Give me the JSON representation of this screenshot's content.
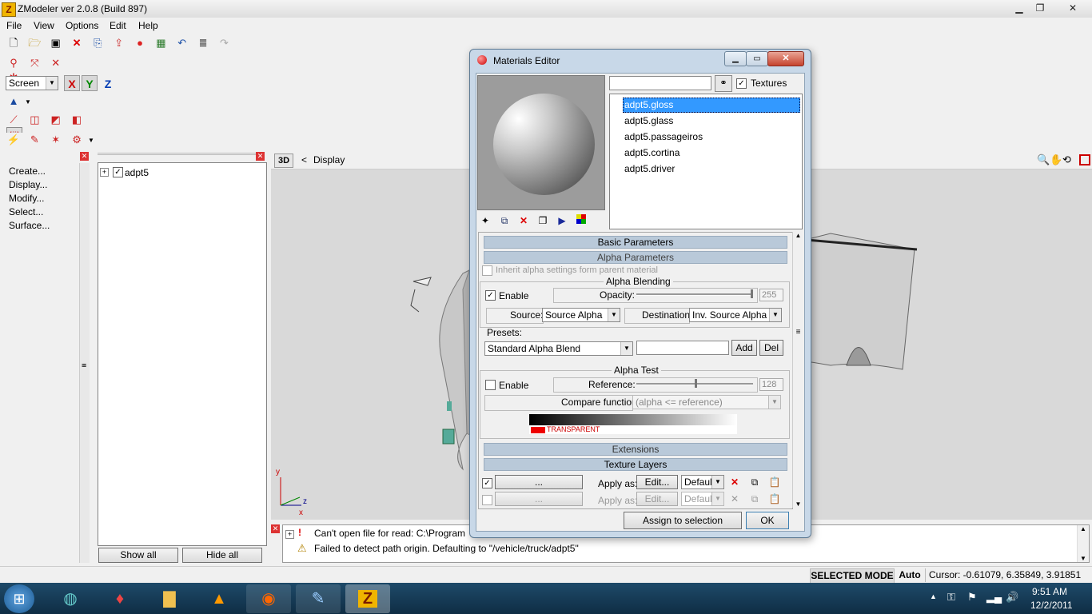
{
  "window": {
    "title": "ZModeler ver 2.0.8 (Build 897)",
    "app_icon": "Z"
  },
  "menu": [
    "File",
    "View",
    "Options",
    "Edit",
    "Help"
  ],
  "toolbar": {
    "coord_mode": "Screen",
    "axes": [
      "X",
      "Y",
      "Z"
    ]
  },
  "commands": [
    "Create...",
    "Display...",
    "Modify...",
    "Select...",
    "Surface..."
  ],
  "tree": {
    "root": "adpt5",
    "show_all": "Show all",
    "hide_all": "Hide all"
  },
  "viewport": {
    "mode": "3D",
    "display_label": "Display",
    "back_arrow": "<",
    "axis_y": "y",
    "axis_x": "x",
    "axis_z": "z"
  },
  "log": {
    "lines": [
      "Can't open file for read: C:\\Program",
      "Failed to detect path origin. Defaulting to \"/vehicle/truck/adpt5\""
    ]
  },
  "status": {
    "mode": "SELECTED MODE",
    "auto": "Auto",
    "cursor": "Cursor: -0.61079, 6.35849, 3.91851"
  },
  "clock": {
    "time": "9:51 AM",
    "date": "12/2/2011"
  },
  "dialog": {
    "title": "Materials Editor",
    "search_value": "",
    "textures_label": "Textures",
    "materials": [
      "adpt5.gloss",
      "adpt5.glass",
      "adpt5.passageiros",
      "adpt5.cortina",
      "adpt5.driver"
    ],
    "selected_material": "adpt5.gloss",
    "sections": {
      "basic": "Basic Parameters",
      "alpha": "Alpha Parameters",
      "extensions": "Extensions",
      "texture_layers": "Texture Layers"
    },
    "inherit_label": "Inherit alpha settings form parent material",
    "alpha_blending": {
      "title": "Alpha Blending",
      "enable_label": "Enable",
      "enabled": true,
      "opacity_label": "Opacity:",
      "opacity_value": "255",
      "opacity_fraction": 1.0,
      "source_label": "Source:",
      "source_value": "Source Alpha",
      "dest_label": "Destination:",
      "dest_value": "Inv. Source Alpha",
      "presets_label": "Presets:",
      "presets_value": "Standard Alpha Blend",
      "preset_name": "",
      "add_label": "Add",
      "del_label": "Del"
    },
    "alpha_test": {
      "title": "Alpha Test",
      "enable_label": "Enable",
      "enabled": false,
      "reference_label": "Reference:",
      "reference_value": "128",
      "reference_fraction": 0.5,
      "compare_label": "Compare function:",
      "compare_value": "(alpha <= reference)",
      "transparent_label": "TRANSPARENT"
    },
    "texture_layers": [
      {
        "enabled": true,
        "button": "...",
        "apply_label": "Apply as:",
        "edit_label": "Edit...",
        "blend": "Default"
      },
      {
        "enabled": false,
        "button": "...",
        "apply_label": "Apply as:",
        "edit_label": "Edit...",
        "blend": "Default"
      }
    ],
    "assign_label": "Assign to selection",
    "ok_label": "OK"
  },
  "colors": {
    "selection": "#3399ff",
    "section_bg": "#b9c9d9",
    "taskbar": "#173a55"
  }
}
